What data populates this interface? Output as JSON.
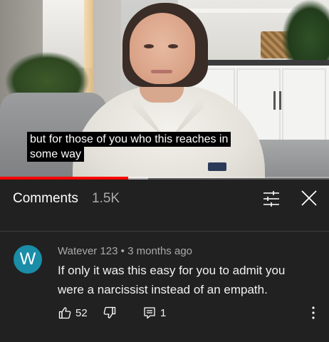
{
  "video": {
    "caption_lines": [
      "but for those of you who this reaches in",
      "some way"
    ],
    "progress_percent": 39,
    "buffer_percent": 45,
    "accent_color": "#ff0000"
  },
  "comments_panel": {
    "title": "Comments",
    "count": "1.5K",
    "filter_icon": "sort-filter-icon",
    "close_icon": "close-icon"
  },
  "comment": {
    "avatar_letter": "W",
    "avatar_color": "#1a8da8",
    "author": "Watever 123",
    "separator": "•",
    "time": "3 months ago",
    "text": "If only it was this easy for you to admit you were a narcissist instead of an empath.",
    "likes": "52",
    "replies": "1",
    "like_icon": "thumbs-up-icon",
    "dislike_icon": "thumbs-down-icon",
    "reply_icon": "reply-icon",
    "more_icon": "more-vertical-icon"
  }
}
